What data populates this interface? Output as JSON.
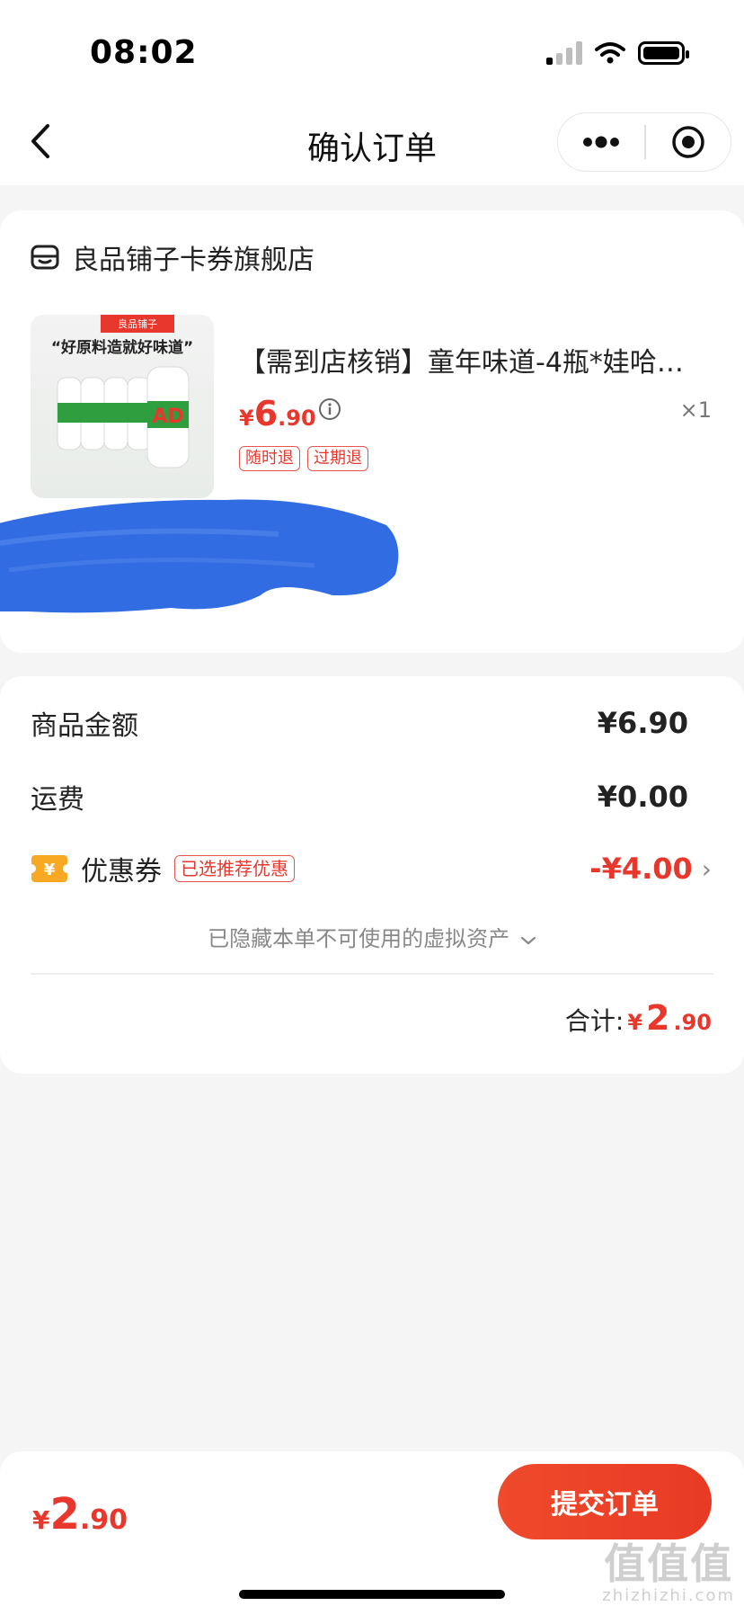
{
  "status_bar": {
    "time": "08:02"
  },
  "nav": {
    "title": "确认订单"
  },
  "store": {
    "name": "良品铺子卡券旗舰店"
  },
  "product": {
    "title": "【需到店核销】童年味道-4瓶*娃哈…",
    "image_banner": "“好原料造就好味道”",
    "image_brand": "良品铺子",
    "price_symbol": "¥",
    "price_int": "6",
    "price_dec": ".90",
    "quantity": "×1",
    "tags": [
      "随时退",
      "过期退"
    ]
  },
  "summary": {
    "goods_label": "商品金额",
    "goods_value": "¥6.90",
    "shipping_label": "运费",
    "shipping_value": "¥0.00",
    "coupon_label": "优惠券",
    "coupon_badge": "已选推荐优惠",
    "coupon_value": "-¥4.00",
    "hidden_assets": "已隐藏本单不可使用的虚拟资产",
    "total_label": "合计:",
    "total_symbol": "¥",
    "total_int": "2",
    "total_dec": ".90"
  },
  "bottom": {
    "price_symbol": "¥",
    "price_int": "2",
    "price_dec": ".90",
    "submit_label": "提交订单"
  },
  "watermark": {
    "logo": "值值值",
    "url": "zhizhizhi.com"
  },
  "colors": {
    "accent": "#e8372c",
    "background": "#f5f5f5",
    "scribble": "#1f5fe0"
  }
}
